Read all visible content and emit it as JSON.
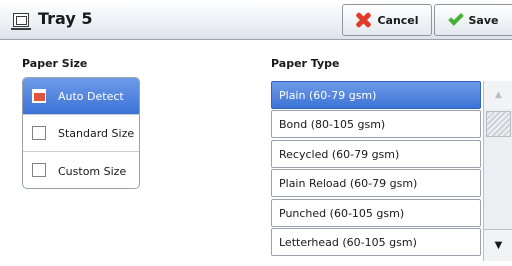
{
  "header": {
    "title": "Tray 5",
    "cancel_label": "Cancel",
    "save_label": "Save"
  },
  "paper_size": {
    "label": "Paper Size",
    "options": [
      {
        "label": "Auto Detect",
        "selected": true
      },
      {
        "label": "Standard Size",
        "selected": false
      },
      {
        "label": "Custom Size",
        "selected": false
      }
    ]
  },
  "paper_type": {
    "label": "Paper Type",
    "items": [
      {
        "label": "Plain (60-79 gsm)",
        "selected": true
      },
      {
        "label": "Bond (80-105 gsm)",
        "selected": false
      },
      {
        "label": "Recycled (60-79 gsm)",
        "selected": false
      },
      {
        "label": "Plain Reload (60-79 gsm)",
        "selected": false
      },
      {
        "label": "Punched (60-105 gsm)",
        "selected": false
      },
      {
        "label": "Letterhead (60-105 gsm)",
        "selected": false
      }
    ]
  },
  "scrollbar": {
    "up_icon": "▲",
    "down_icon": "▼"
  },
  "colors": {
    "selected": "#4a80dd",
    "cancel_icon": "#e23b2b",
    "save_icon": "#48b035"
  }
}
